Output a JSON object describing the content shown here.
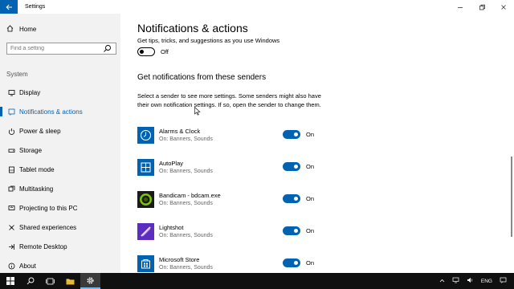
{
  "window": {
    "title": "Settings"
  },
  "sidebar": {
    "home_label": "Home",
    "search_placeholder": "Find a setting",
    "section_label": "System",
    "items": [
      {
        "label": "Display",
        "icon": "display-icon"
      },
      {
        "label": "Notifications & actions",
        "icon": "notifications-icon",
        "active": true
      },
      {
        "label": "Power & sleep",
        "icon": "power-icon"
      },
      {
        "label": "Storage",
        "icon": "storage-icon"
      },
      {
        "label": "Tablet mode",
        "icon": "tablet-icon"
      },
      {
        "label": "Multitasking",
        "icon": "multitasking-icon"
      },
      {
        "label": "Projecting to this PC",
        "icon": "projecting-icon"
      },
      {
        "label": "Shared experiences",
        "icon": "shared-icon"
      },
      {
        "label": "Remote Desktop",
        "icon": "remote-desktop-icon"
      },
      {
        "label": "About",
        "icon": "about-icon"
      }
    ]
  },
  "main": {
    "title": "Notifications & actions",
    "tips": {
      "label": "Get tips, tricks, and suggestions as you use Windows",
      "state": "Off"
    },
    "senders_heading": "Get notifications from these senders",
    "senders_description": "Select a sender to see more settings. Some senders might also have their own notification settings. If so, open the sender to change them.",
    "senders": [
      {
        "name": "Alarms & Clock",
        "sub": "On: Banners, Sounds",
        "state": "On",
        "icon": "alarms-clock-icon",
        "color": "#0063b1"
      },
      {
        "name": "AutoPlay",
        "sub": "On: Banners, Sounds",
        "state": "On",
        "icon": "autoplay-icon",
        "color": "#0063b1"
      },
      {
        "name": "Bandicam - bdcam.exe",
        "sub": "On: Banners, Sounds",
        "state": "On",
        "icon": "bandicam-icon",
        "color": "#1a1a1a"
      },
      {
        "name": "Lightshot",
        "sub": "On: Banners, Sounds",
        "state": "On",
        "icon": "lightshot-icon",
        "color": "#5b2dc0"
      },
      {
        "name": "Microsoft Store",
        "sub": "On: Banners, Sounds",
        "state": "On",
        "icon": "store-icon",
        "color": "#0063b1"
      }
    ]
  },
  "taskbar": {
    "language": "ENG"
  },
  "colors": {
    "accent": "#0063b1",
    "sidebar_bg": "#f2f2f2",
    "taskbar_bg": "#101010"
  }
}
